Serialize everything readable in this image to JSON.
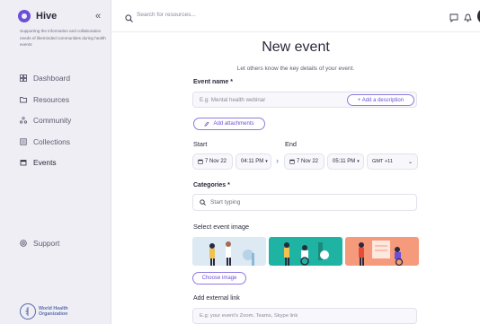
{
  "sidebar": {
    "brand": "Hive",
    "collapse_glyph": "«",
    "tagline": "Supporting the information and collaboration needs of likeminded communities during health events",
    "nav": [
      {
        "label": "Dashboard",
        "icon": "dashboard-icon"
      },
      {
        "label": "Resources",
        "icon": "folder-icon"
      },
      {
        "label": "Community",
        "icon": "community-icon"
      },
      {
        "label": "Collections",
        "icon": "collections-icon"
      },
      {
        "label": "Events",
        "icon": "calendar-icon"
      }
    ],
    "support": "Support",
    "org_line1": "World Health",
    "org_line2": "Organization"
  },
  "topbar": {
    "search_placeholder": "Search for resources..."
  },
  "form": {
    "title": "New event",
    "subtitle": "Let others know the key details of your event.",
    "event_name_label": "Event name *",
    "event_name_placeholder": "E.g: Mental health webinar",
    "add_description": "+ Add a description",
    "add_attachments": "Add attachments",
    "start_label": "Start",
    "end_label": "End",
    "start_date": "7 Nov 22",
    "start_time": "04:11 PM",
    "end_date": "7 Nov 22",
    "end_time": "05:11 PM",
    "timezone": "GMT +11",
    "categories_label": "Categories *",
    "categories_placeholder": "Start typing",
    "select_image_label": "Select event image",
    "choose_image": "Choose image",
    "external_link_label": "Add external link",
    "external_link_placeholder": "E.g: your event's Zoom, Teams, Skype link"
  },
  "colors": {
    "accent": "#6b4fd8",
    "card1": "#dde9f3",
    "card2": "#1fb3a3",
    "card3": "#f59a7a"
  }
}
